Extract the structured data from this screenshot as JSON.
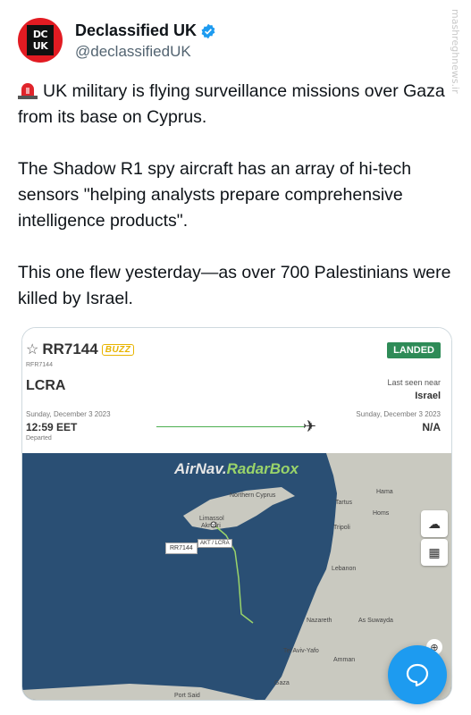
{
  "author": {
    "display_name": "Declassified UK",
    "handle": "@declassifiedUK",
    "avatar_text_line1": "DC",
    "avatar_text_line2": "UK",
    "verified": true
  },
  "tweet": {
    "paragraph1": "UK military is flying surveillance missions over Gaza from its base on Cyprus.",
    "paragraph2": "The Shadow R1 spy aircraft has an array of hi-tech sensors \"helping analysts prepare comprehensive intelligence products\".",
    "paragraph3": "This one flew yesterday—as over 700 Palestinians were killed by Israel.",
    "leading_icon": "rotating-light-icon"
  },
  "watermark": "mashreghnews.ir",
  "flight_card": {
    "flight_number": "RR7144",
    "airline_tag": "BUZZ",
    "callsign": "RFR7144",
    "status": "LANDED",
    "origin": "LCRA",
    "last_seen_label": "Last seen near",
    "last_seen_value": "Israel",
    "departure_date": "Sunday, December 3 2023",
    "departure_time": "12:59 EET",
    "departure_status": "Departed",
    "arrival_date": "Sunday, December 3 2023",
    "arrival_value": "N/A"
  },
  "map": {
    "brand_main": "AirNav.",
    "brand_accent": "RadarBox",
    "track_label": "AKT / LCRA",
    "plane_tag": "RR7144",
    "labels": {
      "northern_cyprus": "Northern Cyprus",
      "limassol": "Limassol",
      "akrotiri": "Akrotiri",
      "hama": "Hama",
      "tartus": "Tartus",
      "homs": "Homs",
      "tripoli": "Tripoli",
      "lebanon": "Lebanon",
      "nazareth": "Nazareth",
      "as_suwayda": "As Suwayda",
      "tel_aviv": "Tel Aviv-Yafo",
      "amman": "Amman",
      "gaza": "Gaza",
      "port_said": "Port Said"
    },
    "colors": {
      "sea": "#2a4f74",
      "land": "#c9c9c0",
      "track": "#9ad46a"
    }
  },
  "compose_button_icon": "message-bubble-icon"
}
